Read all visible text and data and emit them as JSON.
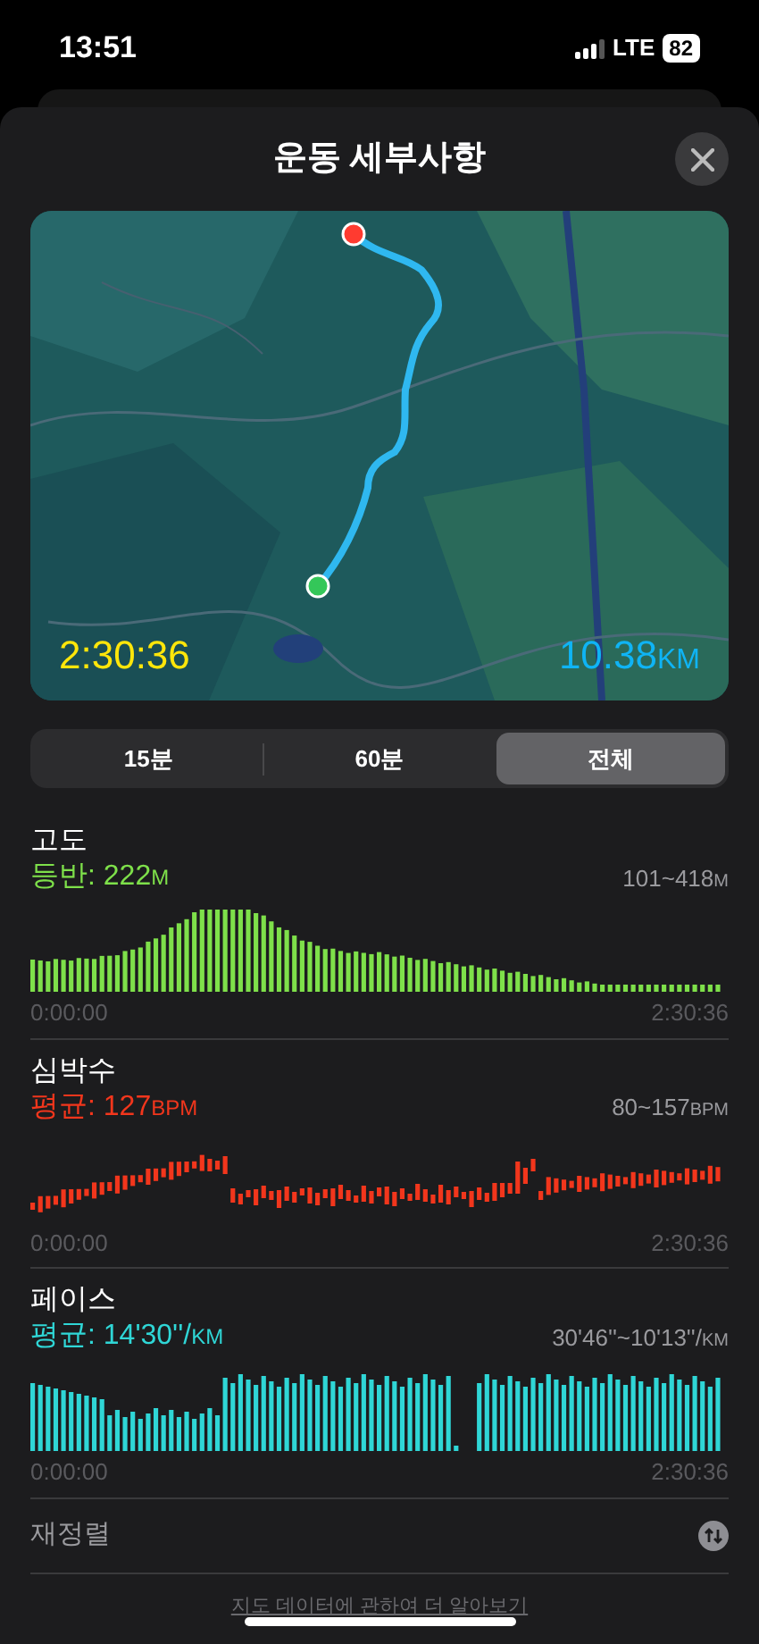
{
  "status_bar": {
    "time": "13:51",
    "network": "LTE",
    "battery": "82"
  },
  "title": "운동 세부사항",
  "map": {
    "duration": "2:30:36",
    "distance": "10.38",
    "distance_unit": "KM"
  },
  "tabs": [
    {
      "label": "15분",
      "selected": false
    },
    {
      "label": "60분",
      "selected": false
    },
    {
      "label": "전체",
      "selected": true
    }
  ],
  "metrics": [
    {
      "kind": "elevation",
      "title": "고도",
      "summary_label": "등반:",
      "summary_value": "222",
      "summary_unit": "M",
      "range": "101~418",
      "range_unit": "M",
      "color": "#7ee04a",
      "start": "0:00:00",
      "end": "2:30:36"
    },
    {
      "kind": "heart",
      "title": "심박수",
      "summary_label": "평균:",
      "summary_value": "127",
      "summary_unit": "BPM",
      "range": "80~157",
      "range_unit": "BPM",
      "color": "#f2361c",
      "start": "0:00:00",
      "end": "2:30:36"
    },
    {
      "kind": "pace",
      "title": "페이스",
      "summary_label": "평균:",
      "summary_value": "14'30''/",
      "summary_unit": "KM",
      "range": "30'46''~10'13''/",
      "range_unit": "KM",
      "color": "#2fd6d6",
      "start": "0:00:00",
      "end": "2:30:36"
    }
  ],
  "reorder": {
    "label": "재정렬"
  },
  "footer_link": "지도 데이터에 관하여 더 알아보기"
}
